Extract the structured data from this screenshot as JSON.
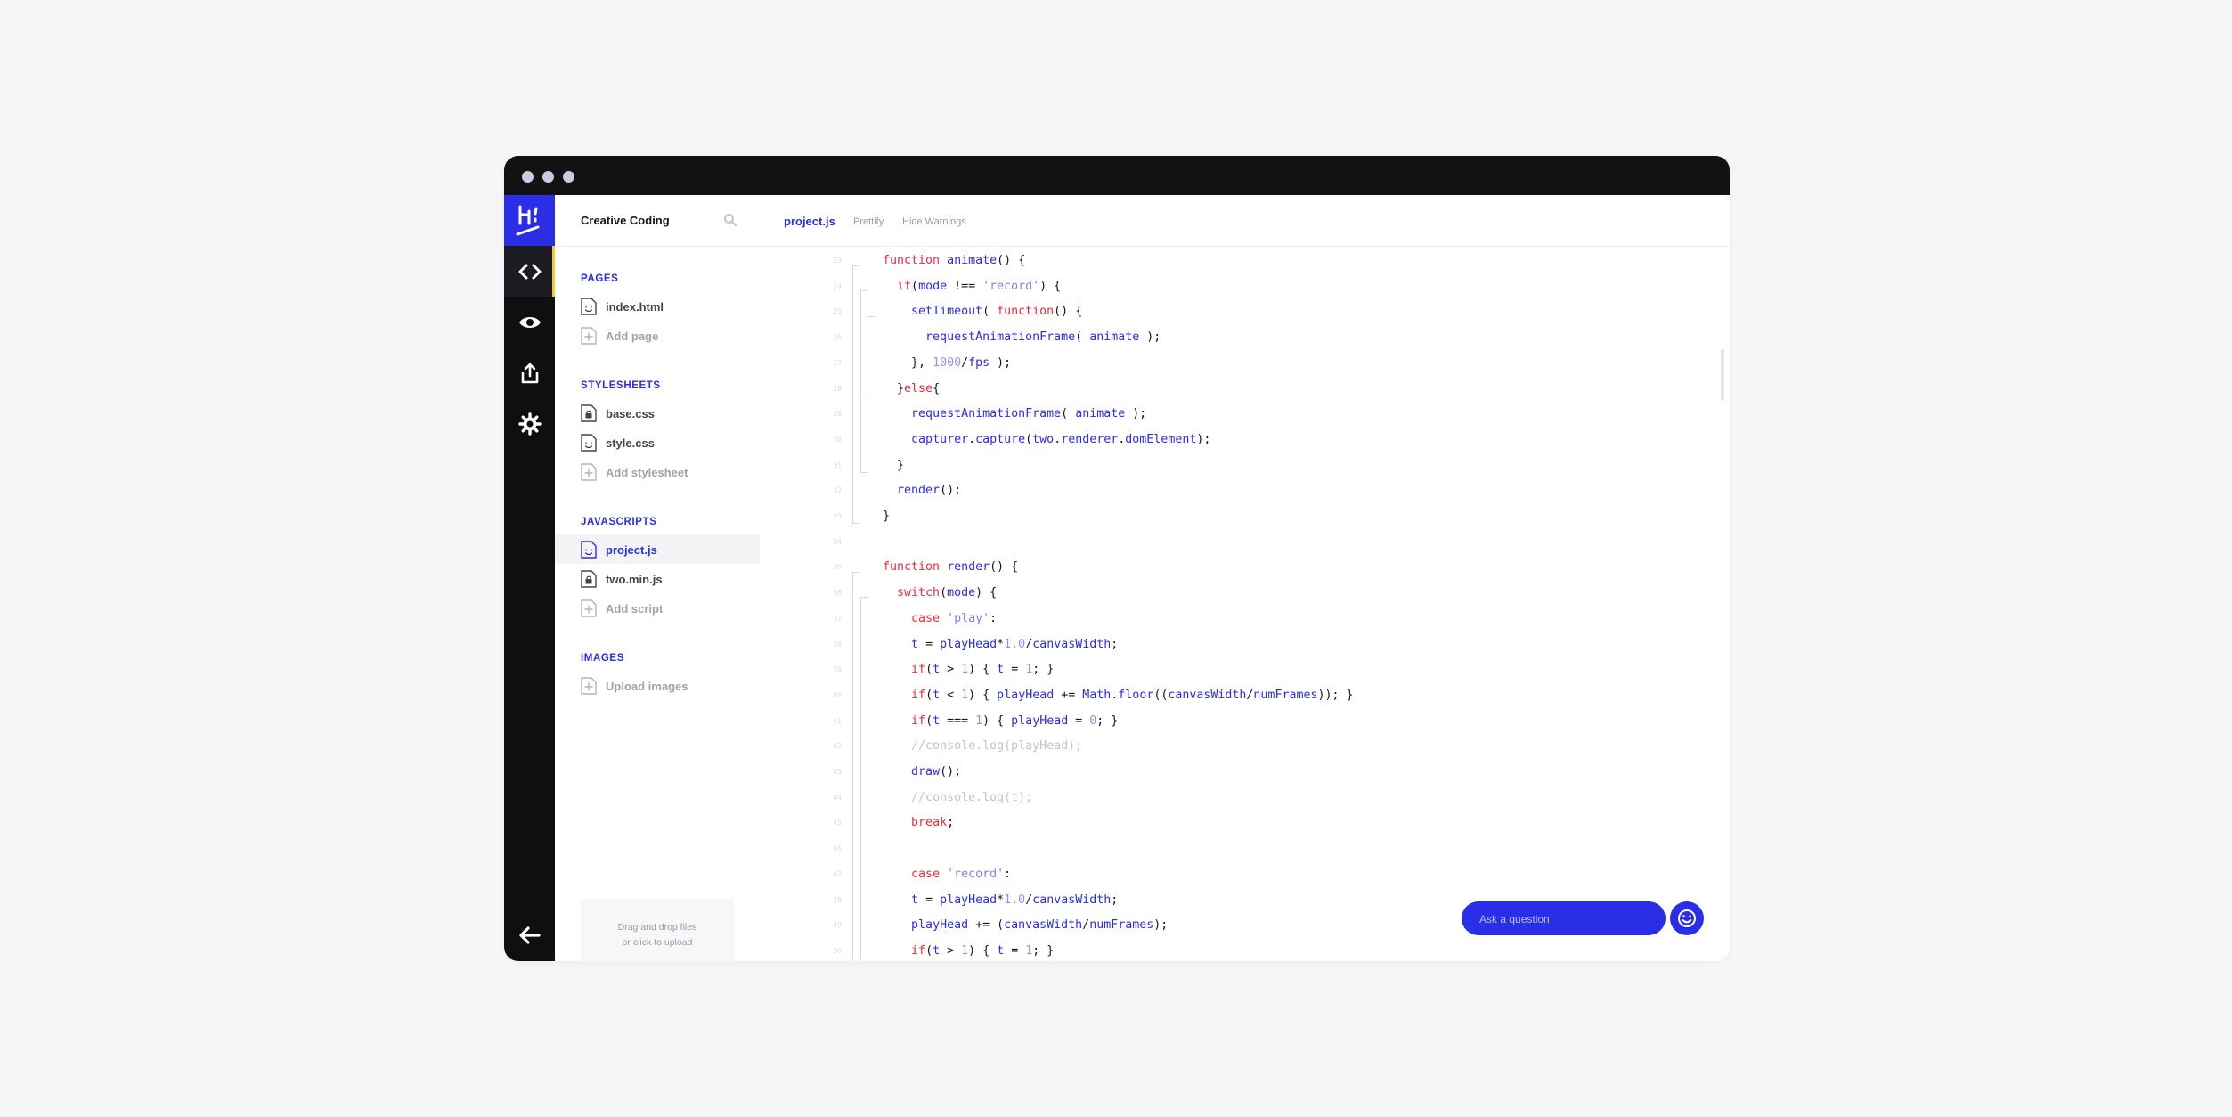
{
  "sidebar": {
    "project_title": "Creative Coding",
    "sections": {
      "pages": {
        "label": "PAGES",
        "files": [
          "index.html"
        ],
        "add_label": "Add page"
      },
      "stylesheets": {
        "label": "STYLESHEETS",
        "files": [
          "base.css",
          "style.css"
        ],
        "add_label": "Add stylesheet"
      },
      "javascripts": {
        "label": "JAVASCRIPTS",
        "files": [
          "project.js",
          "two.min.js"
        ],
        "add_label": "Add script"
      },
      "images": {
        "label": "IMAGES",
        "add_label": "Upload images"
      }
    },
    "dropzone": {
      "line1": "Drag and drop files",
      "line2": "or click to upload"
    }
  },
  "editor": {
    "active_tab": "project.js",
    "actions": [
      "Prettify",
      "Hide Warnings"
    ],
    "code_lines": [
      "  function animate() {",
      "    if(mode !== 'record') {",
      "      setTimeout( function() {",
      "        requestAnimationFrame( animate );",
      "      }, 1000/fps );",
      "    }else{",
      "      requestAnimationFrame( animate );",
      "      capturer.capture(two.renderer.domElement);",
      "    }",
      "    render();",
      "  }",
      "",
      "  function render() {",
      "    switch(mode) {",
      "      case 'play':",
      "      t = playHead*1.0/canvasWidth;",
      "      if(t > 1) { t = 1; }",
      "      if(t < 1) { playHead += Math.floor((canvasWidth/numFrames)); }",
      "      if(t === 1) { playHead = 0; }",
      "      //console.log(playHead);",
      "      draw();",
      "      //console.log(t);",
      "      break;",
      "",
      "      case 'record':",
      "      t = playHead*1.0/canvasWidth;",
      "      playHead += (canvasWidth/numFrames);",
      "      if(t > 1) { t = 1; }"
    ]
  },
  "help": {
    "placeholder": "Ask a question"
  },
  "icons": {
    "logo": "hi-logo-icon",
    "code": "code-icon",
    "preview": "eye-icon",
    "share": "share-icon",
    "settings": "gear-icon",
    "back": "arrow-left-icon",
    "search": "search-icon",
    "help": "smiley-icon"
  },
  "colors": {
    "accent": "#2a2ee6",
    "keyword": "#ee2b3b",
    "rail": "#0f0f12",
    "titlebar": "#121212",
    "active_indicator": "#f5c93a"
  }
}
